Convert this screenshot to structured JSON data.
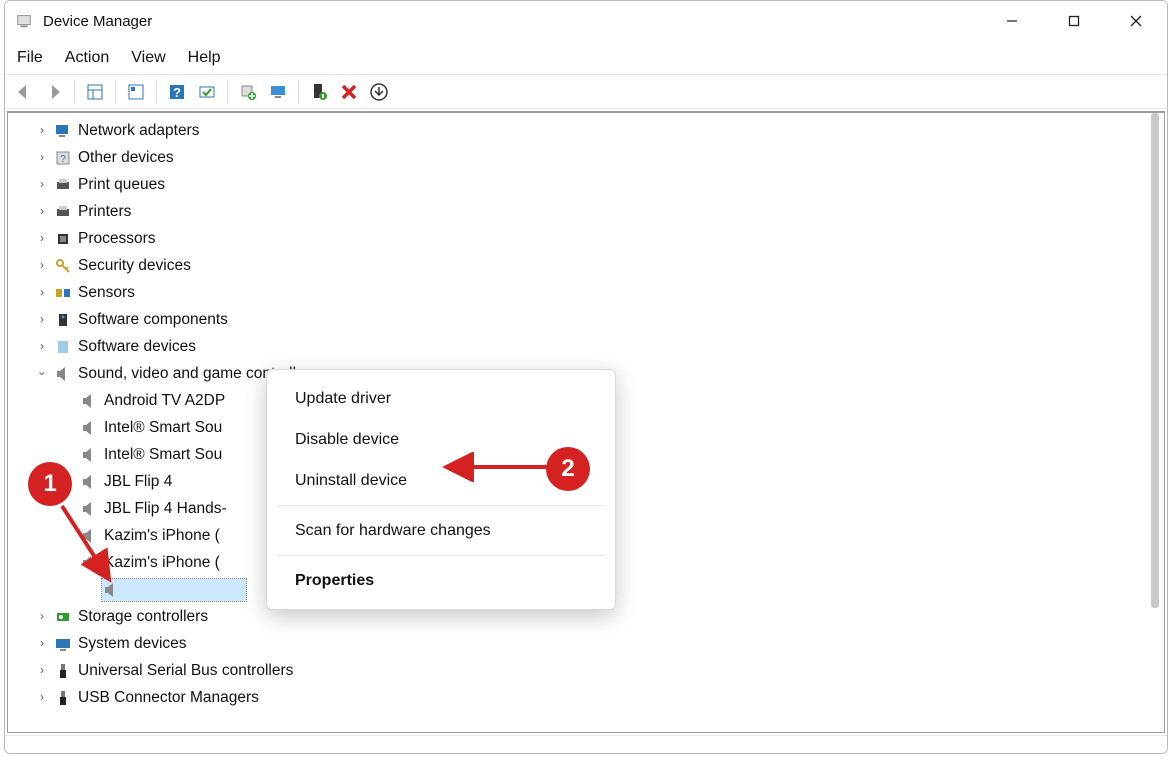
{
  "window": {
    "title": "Device Manager"
  },
  "menubar": {
    "file": "File",
    "action": "Action",
    "view": "View",
    "help": "Help"
  },
  "tree": {
    "collapsed": [
      {
        "label": "Network adapters"
      },
      {
        "label": "Other devices"
      },
      {
        "label": "Print queues"
      },
      {
        "label": "Printers"
      },
      {
        "label": "Processors"
      },
      {
        "label": "Security devices"
      },
      {
        "label": "Sensors"
      },
      {
        "label": "Software components"
      },
      {
        "label": "Software devices"
      }
    ],
    "expanded": {
      "label": "Sound, video and game controllers",
      "children": [
        {
          "label": "Android TV A2DP"
        },
        {
          "label": "Intel® Smart Sou"
        },
        {
          "label": "Intel® Smart Sou"
        },
        {
          "label": "JBL Flip 4"
        },
        {
          "label": "JBL Flip 4 Hands-"
        },
        {
          "label": "Kazim's iPhone ("
        },
        {
          "label": "Kazim's iPhone ("
        }
      ]
    },
    "after": [
      {
        "label": "Storage controllers"
      },
      {
        "label": "System devices"
      },
      {
        "label": "Universal Serial Bus controllers"
      },
      {
        "label": "USB Connector Managers"
      }
    ]
  },
  "contextMenu": {
    "update": "Update driver",
    "disable": "Disable device",
    "uninstall": "Uninstall device",
    "scan": "Scan for hardware changes",
    "properties": "Properties"
  },
  "annotations": {
    "badge1": "1",
    "badge2": "2"
  }
}
